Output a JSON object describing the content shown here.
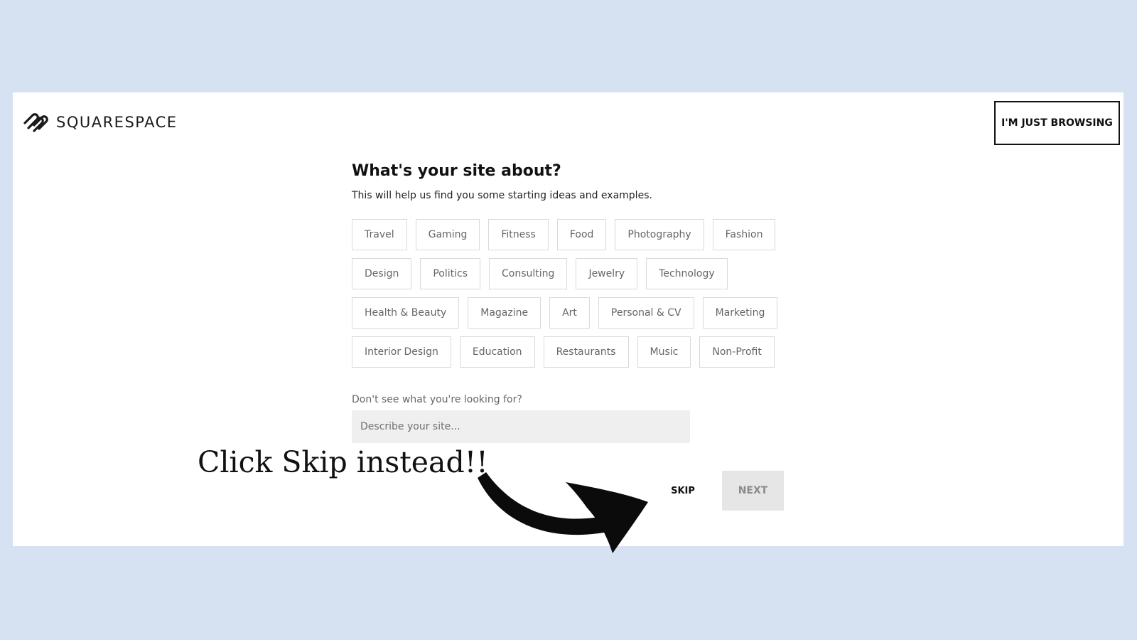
{
  "header": {
    "logo_text": "SQUARESPACE",
    "browse_button": "I'M JUST BROWSING"
  },
  "main": {
    "title": "What's your site about?",
    "subtitle": "This will help us find you some starting ideas and examples.",
    "tag_rows": [
      [
        "Travel",
        "Gaming",
        "Fitness",
        "Food",
        "Photography",
        "Fashion"
      ],
      [
        "Design",
        "Politics",
        "Consulting",
        "Jewelry",
        "Technology"
      ],
      [
        "Health & Beauty",
        "Magazine",
        "Art",
        "Personal & CV",
        "Marketing"
      ],
      [
        "Interior Design",
        "Education",
        "Restaurants",
        "Music",
        "Non-Profit"
      ]
    ],
    "prompt_label": "Don't see what you're looking for?",
    "describe_placeholder": "Describe your site...",
    "describe_value": ""
  },
  "footer": {
    "skip_label": "SKIP",
    "next_label": "NEXT"
  },
  "annotation": {
    "text": "Click Skip instead!!"
  },
  "icons": {
    "logo": "squarespace-logo-icon",
    "annotation_arrow": "curved-arrow-icon"
  },
  "colors": {
    "backdrop": "#d6e2f1",
    "card": "#ffffff",
    "accent": "#111111",
    "disabled_button": "#e6e6e6",
    "input_background": "#efefef"
  }
}
